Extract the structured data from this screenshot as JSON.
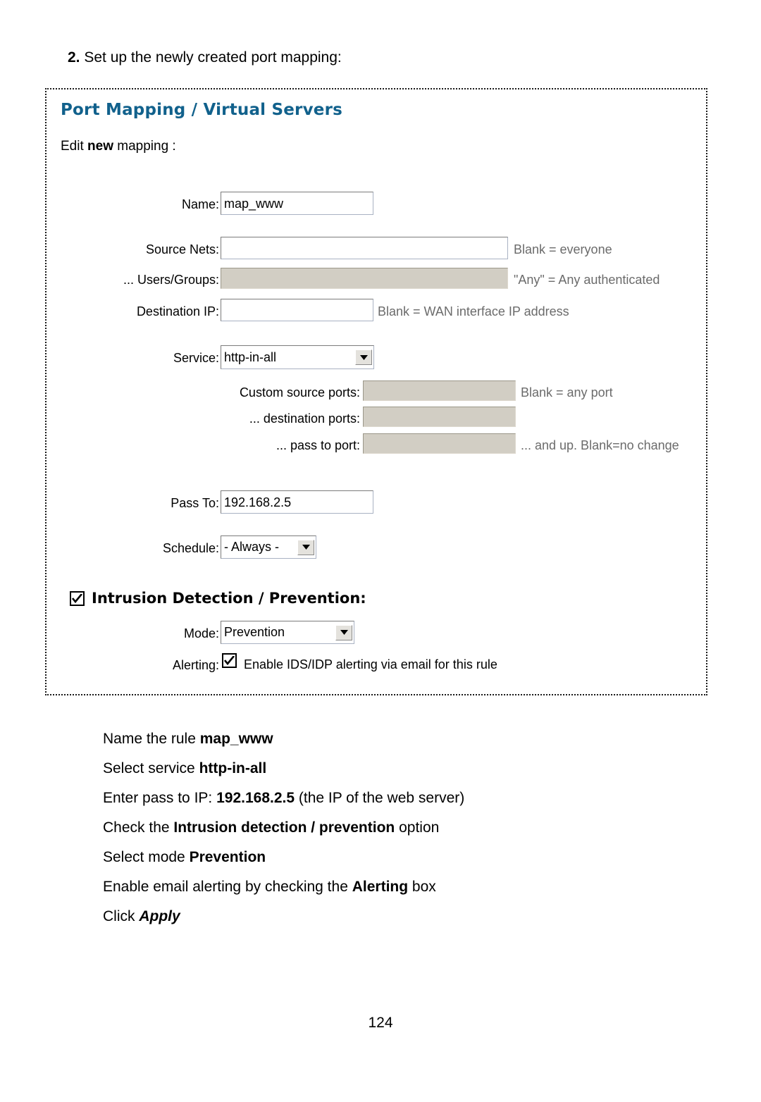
{
  "step": {
    "number": "2.",
    "text": "Set up the newly created port mapping:"
  },
  "panel": {
    "title": "Port Mapping / Virtual Servers",
    "edit_prefix": "Edit ",
    "edit_bold": "new",
    "edit_suffix": " mapping :",
    "fields": {
      "name": {
        "label": "Name:",
        "value": "map_www"
      },
      "source_nets": {
        "label": "Source Nets:",
        "value": "",
        "hint": "Blank = everyone"
      },
      "users_groups": {
        "label": "... Users/Groups:",
        "value": "",
        "hint": "\"Any\" = Any authenticated"
      },
      "destination_ip": {
        "label": "Destination IP:",
        "value": "",
        "hint": "Blank = WAN interface IP address"
      },
      "service": {
        "label": "Service:",
        "value": "http-in-all"
      },
      "custom_source_ports": {
        "label": "Custom source ports:",
        "value": "",
        "hint": "Blank = any port"
      },
      "destination_ports": {
        "label": "... destination ports:",
        "value": "",
        "hint": ""
      },
      "pass_to_port": {
        "label": "... pass to port:",
        "value": "",
        "hint": "... and up. Blank=no change"
      },
      "pass_to": {
        "label": "Pass To:",
        "value": "192.168.2.5"
      },
      "schedule": {
        "label": "Schedule:",
        "value": "- Always -"
      }
    },
    "ids": {
      "title": "Intrusion Detection / Prevention:",
      "checked": true,
      "mode": {
        "label": "Mode:",
        "value": "Prevention"
      },
      "alerting": {
        "label": "Alerting:",
        "checked": true,
        "text": "Enable IDS/IDP alerting via email for this rule"
      }
    }
  },
  "instructions": [
    {
      "prefix": "Name the rule ",
      "bold": "map_www",
      "suffix": "",
      "italic": ""
    },
    {
      "prefix": "Select service ",
      "bold": "http-in-all",
      "suffix": "",
      "italic": ""
    },
    {
      "prefix": "Enter pass to IP: ",
      "bold": "192.168.2.5",
      "suffix": " (the IP of the web server)",
      "italic": ""
    },
    {
      "prefix": "Check the ",
      "bold": "Intrusion detection / prevention",
      "suffix": " option",
      "italic": ""
    },
    {
      "prefix": "Select mode ",
      "bold": "Prevention",
      "suffix": "",
      "italic": ""
    },
    {
      "prefix": "Enable email alerting by checking the ",
      "bold": "Alerting",
      "suffix": " box",
      "italic": ""
    },
    {
      "prefix": "Click ",
      "bold": "",
      "suffix": "",
      "italic": "Apply"
    }
  ],
  "page_number": "124",
  "colors": {
    "heading": "#11618c",
    "hint_text": "#6b6b6b",
    "disabled_field": "#d2cec4"
  }
}
